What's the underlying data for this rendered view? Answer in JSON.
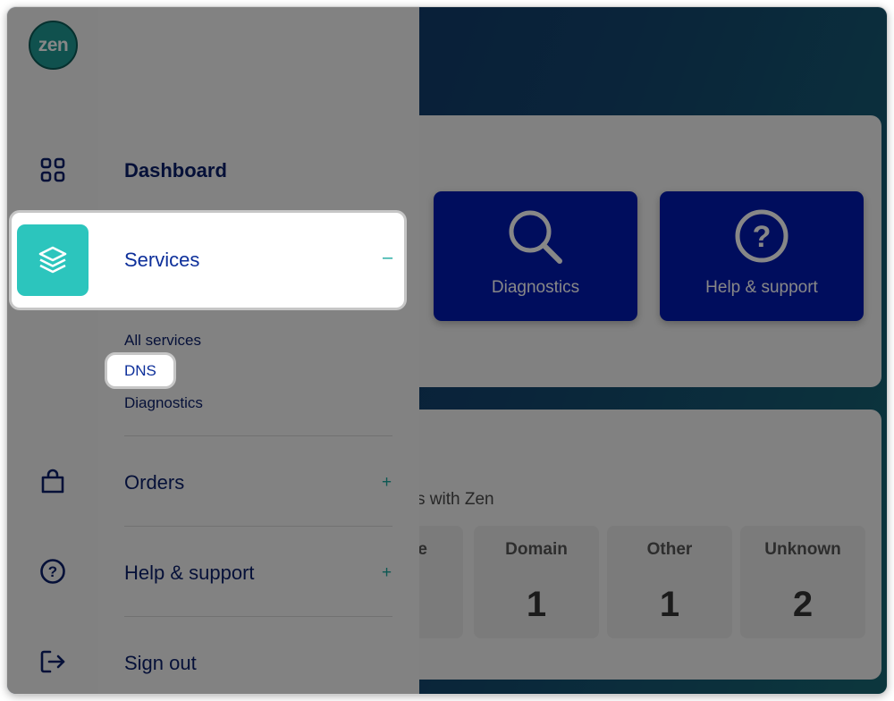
{
  "brand": {
    "logo_text": "zen",
    "accent": "#2cc5bd",
    "navy": "#0b1f6b",
    "tile_blue": "#0019b0"
  },
  "rail": {
    "icons": [
      "dashboard-grid-icon",
      "layers-icon",
      "shopping-bag-icon",
      "help-circle-icon",
      "sign-out-icon"
    ]
  },
  "menu": {
    "dashboard": "Dashboard",
    "services": "Services",
    "services_toggle": "–",
    "services_sub": [
      "All services",
      "DNS",
      "Diagnostics"
    ],
    "orders": "Orders",
    "orders_toggle": "+",
    "help": "Help & support",
    "help_toggle": "+",
    "signout": "Sign out"
  },
  "background": {
    "tiles": [
      {
        "label": "Diagnostics",
        "icon": "search-icon"
      },
      {
        "label": "Help & support",
        "icon": "question-circle-icon"
      }
    ],
    "partial_text": "s with Zen",
    "stats": [
      {
        "label": "e",
        "value": ""
      },
      {
        "label": "Domain",
        "value": "1"
      },
      {
        "label": "Other",
        "value": "1"
      },
      {
        "label": "Unknown",
        "value": "2"
      }
    ]
  }
}
